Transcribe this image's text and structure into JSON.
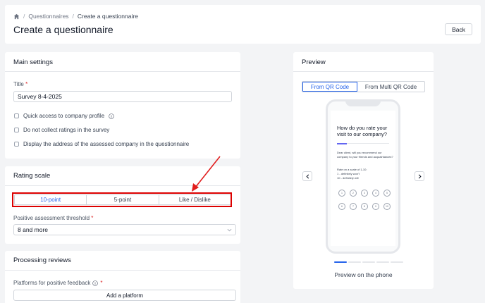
{
  "breadcrumb": {
    "items": [
      "Questionnaires",
      "Create a questionnaire"
    ]
  },
  "header": {
    "title": "Create a questionnaire",
    "back_label": "Back"
  },
  "main_settings": {
    "title": "Main settings",
    "title_label": "Title",
    "title_value": "Survey 8-4-2025",
    "checkboxes": [
      "Quick access to company profile",
      "Do not collect ratings in the survey",
      "Display the address of the assessed company in the questionnaire"
    ]
  },
  "rating_scale": {
    "title": "Rating scale",
    "options": [
      "10-point",
      "5-point",
      "Like / Dislike"
    ],
    "threshold_label": "Positive assessment threshold",
    "threshold_value": "8 and more"
  },
  "processing": {
    "title": "Processing reviews",
    "platforms_label": "Platforms for positive feedback",
    "add_platform_label": "Add a platform"
  },
  "preview": {
    "title": "Preview",
    "tabs": [
      "From QR Code",
      "From Multi QR Code"
    ],
    "phone": {
      "question": "How do you rate your visit to our company?",
      "body": "Dear client, will you recommend our company to your friends and acquaintances?",
      "scale_intro": "Rate on a scale of 1-10:",
      "scale_low": "1 - definitely won't",
      "scale_high": "10 - definitely will",
      "numbers": [
        "1",
        "2",
        "3",
        "4",
        "5",
        "6",
        "7",
        "8",
        "9",
        "10"
      ]
    },
    "caption": "Preview on the phone",
    "pager_active": 0,
    "pager_count": 5
  },
  "colors": {
    "accent": "#2563eb",
    "highlight": "#dc0000",
    "required": "#dc2626",
    "arrow": "#e11d1d"
  }
}
